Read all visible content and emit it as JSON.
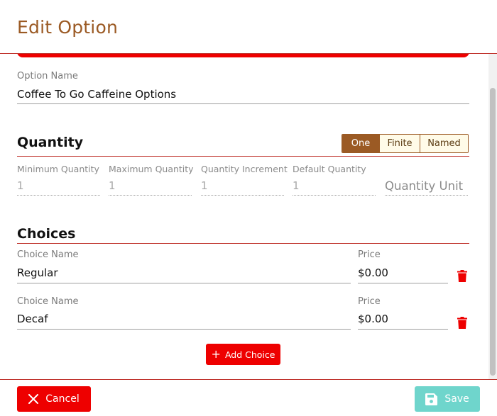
{
  "dialog": {
    "title": "Edit Option"
  },
  "option": {
    "name_label": "Option Name",
    "name_value": "Coffee To Go Caffeine Options"
  },
  "quantity": {
    "title": "Quantity",
    "modes": [
      {
        "label": "One",
        "active": true
      },
      {
        "label": "Finite",
        "active": false
      },
      {
        "label": "Named",
        "active": false
      }
    ],
    "fields": [
      {
        "label": "Minimum Quantity",
        "value": "1"
      },
      {
        "label": "Maximum Quantity",
        "value": "1"
      },
      {
        "label": "Quantity Increment",
        "value": "1"
      },
      {
        "label": "Default Quantity",
        "value": "1"
      }
    ],
    "unit_placeholder": "Quantity Unit"
  },
  "choices": {
    "title": "Choices",
    "items": [
      {
        "name_label": "Choice Name",
        "name_value": "Regular",
        "price_label": "Price",
        "price_value": "$0.00"
      },
      {
        "name_label": "Choice Name",
        "name_value": "Decaf",
        "price_label": "Price",
        "price_value": "$0.00"
      }
    ],
    "add_label": "Add Choice"
  },
  "footer": {
    "cancel_label": "Cancel",
    "save_label": "Save"
  },
  "colors": {
    "accent_brown": "#9b5a24",
    "danger_red": "#ee0000",
    "divider_red": "#c0342e",
    "save_teal": "#6fd5cc"
  }
}
